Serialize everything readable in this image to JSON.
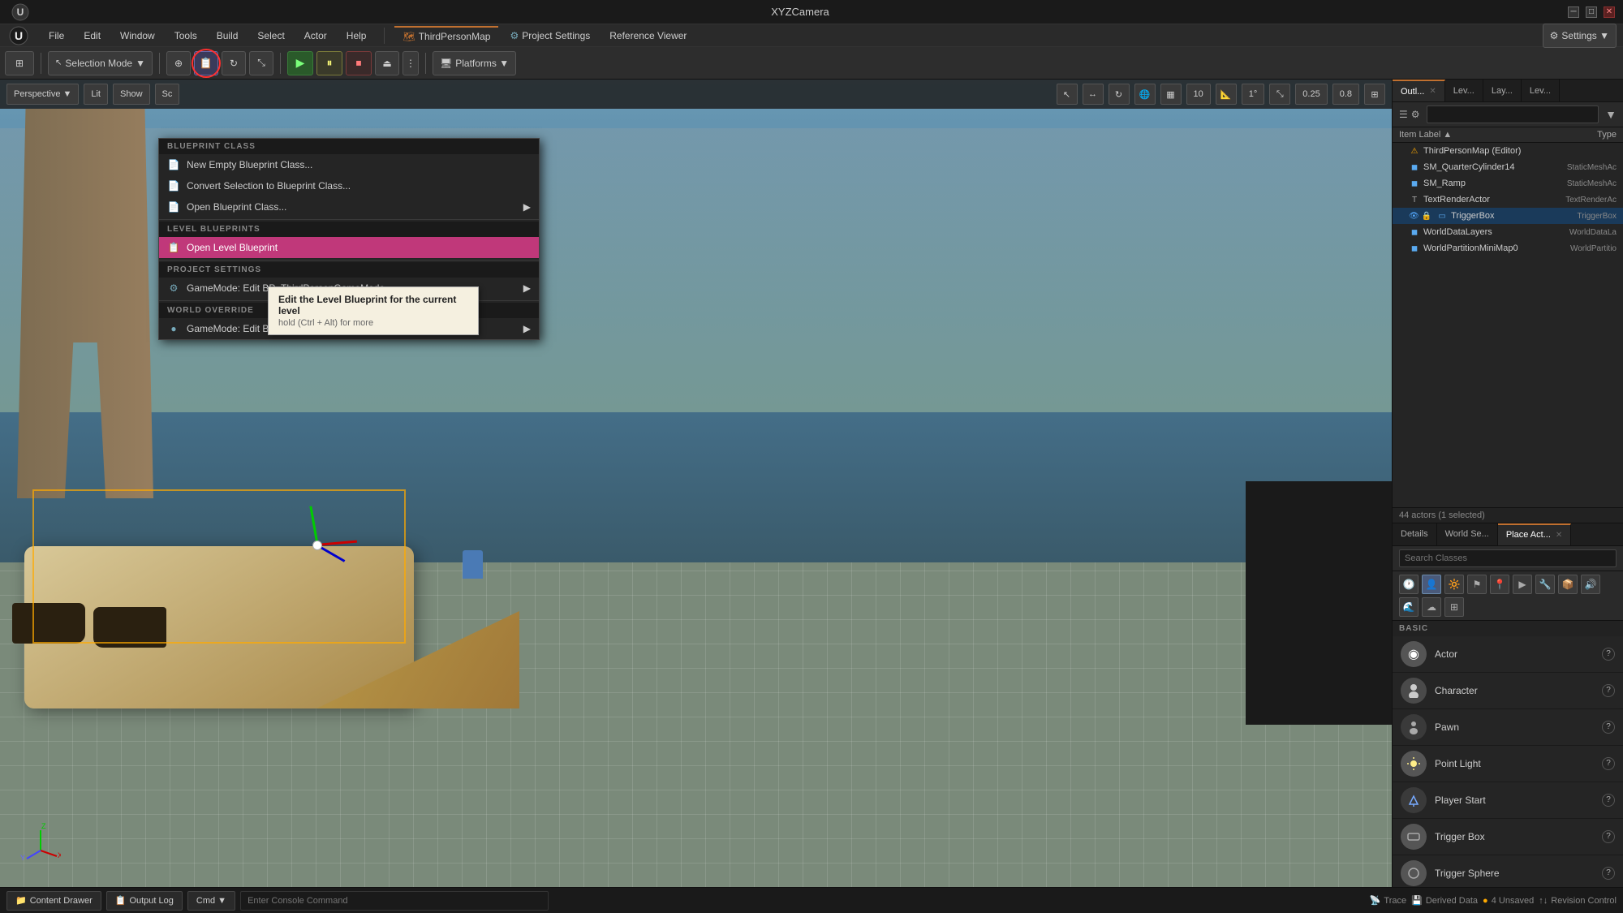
{
  "titlebar": {
    "title": "XYZCamera",
    "minimize": "─",
    "maximize": "□",
    "close": "✕"
  },
  "menubar": {
    "logo_alt": "Unreal Engine Logo",
    "tabs": [
      {
        "label": "ThirdPersonMap",
        "icon": "🗺"
      },
      {
        "label": "Project Settings"
      },
      {
        "label": "Reference Viewer"
      }
    ],
    "menus": [
      {
        "label": "File"
      },
      {
        "label": "Edit"
      },
      {
        "label": "Window"
      },
      {
        "label": "Tools"
      },
      {
        "label": "Build"
      },
      {
        "label": "Select"
      },
      {
        "label": "Actor"
      },
      {
        "label": "Help"
      }
    ]
  },
  "toolbar": {
    "selection_mode": "Selection Mode",
    "selection_mode_icon": "▼",
    "transform_icon": "⊕",
    "play_label": "▶",
    "pause_label": "⏸",
    "stop_label": "⏹",
    "eject_label": "⏏",
    "settings_label": "Settings ▼",
    "platforms_label": "Platforms ▼"
  },
  "viewport": {
    "toolbar": {
      "perspective_label": "Perspective",
      "lit_label": "Lit",
      "show_label": "Show",
      "sc_label": "Sc",
      "icons": [
        "🔍",
        "↔",
        "↻",
        "🌐",
        "▦",
        "▤",
        "10",
        "▤",
        "1°",
        "0.25",
        "0.8",
        "⊞"
      ]
    }
  },
  "blueprint_menu": {
    "sections": [
      {
        "header": "BLUEPRINT CLASS",
        "items": [
          {
            "label": "New Empty Blueprint Class...",
            "icon": "📄",
            "has_arrow": false
          },
          {
            "label": "Convert Selection to Blueprint Class...",
            "icon": "📄",
            "has_arrow": false
          },
          {
            "label": "Open Blueprint Class...",
            "icon": "📄",
            "has_arrow": true
          }
        ]
      },
      {
        "header": "LEVEL BLUEPRINTS",
        "items": [
          {
            "label": "Open Level Blueprint",
            "icon": "📋",
            "has_arrow": false,
            "active": true
          }
        ]
      },
      {
        "header": "PROJECT SETTINGS",
        "items": [
          {
            "label": "GameMode: Edit BP_ThirdPersonGameMode",
            "icon": "⚙",
            "has_arrow": true
          }
        ]
      },
      {
        "header": "WORLD OVERRIDE",
        "items": [
          {
            "label": "GameMode: Edit BP_ThirdPersonGameMode",
            "icon": "●",
            "has_arrow": true
          }
        ]
      }
    ]
  },
  "tooltip": {
    "title": "Edit the Level Blueprint for the current level",
    "sub": "hold (Ctrl + Alt) for more"
  },
  "right_panel": {
    "tabs": [
      {
        "label": "Outl...",
        "active": true,
        "closeable": true
      },
      {
        "label": "Lev...",
        "active": false,
        "closeable": false
      },
      {
        "label": "Lay...",
        "active": false,
        "closeable": false
      },
      {
        "label": "Lev...",
        "active": false,
        "closeable": false
      }
    ],
    "search_placeholder": "",
    "columns": [
      {
        "label": "Item Label ▲"
      },
      {
        "label": "Type"
      }
    ],
    "items": [
      {
        "label": "ThirdPersonMap (Editor)",
        "icon": "⚠",
        "type": "",
        "indent": 0,
        "icon_color": "#ffaa00"
      },
      {
        "label": "SM_QuarterCylinder14",
        "icon": "◼",
        "type": "StaticMeshAc",
        "indent": 1,
        "icon_color": "#5af"
      },
      {
        "label": "SM_Ramp",
        "icon": "◼",
        "type": "StaticMeshAc",
        "indent": 1,
        "icon_color": "#5af"
      },
      {
        "label": "TextRenderActor",
        "icon": "T",
        "type": "TextRenderAc",
        "indent": 1,
        "icon_color": "#aaa"
      },
      {
        "label": "TriggerBox",
        "icon": "▭",
        "type": "TriggerBox",
        "indent": 1,
        "icon_color": "#5af",
        "selected": true,
        "visible": true,
        "locked": false
      },
      {
        "label": "WorldDataLayers",
        "icon": "◼",
        "type": "WorldDataLa",
        "indent": 1,
        "icon_color": "#5af"
      },
      {
        "label": "WorldPartitionMiniMap0",
        "icon": "◼",
        "type": "WorldPartitio",
        "indent": 1,
        "icon_color": "#5af"
      }
    ],
    "actor_count": "44 actors (1 selected)"
  },
  "bottom_panel": {
    "tabs": [
      {
        "label": "Details",
        "active": false
      },
      {
        "label": "World Se...",
        "active": false
      },
      {
        "label": "Place Act...",
        "active": true,
        "closeable": true
      }
    ],
    "search_placeholder": "Search Classes",
    "filter_icons": [
      "🕐",
      "👤",
      "🔆",
      "⚑",
      "📍",
      "▶",
      "🔧",
      "📦",
      "🔊",
      "🌊",
      "☁",
      "⊞"
    ],
    "section_label": "BASIC",
    "actors": [
      {
        "label": "Actor",
        "icon": "◉",
        "icon_bg": "#555"
      },
      {
        "label": "Character",
        "icon": "👤",
        "icon_bg": "#555"
      },
      {
        "label": "Pawn",
        "icon": "👤",
        "icon_bg": "#3a3a3a"
      },
      {
        "label": "Point Light",
        "icon": "💡",
        "icon_bg": "#555"
      },
      {
        "label": "Player Start",
        "icon": "🎮",
        "icon_bg": "#3a3a3a"
      },
      {
        "label": "Trigger Box",
        "icon": "▭",
        "icon_bg": "#555"
      },
      {
        "label": "Trigger Sphere",
        "icon": "◯",
        "icon_bg": "#555"
      }
    ]
  },
  "bottombar": {
    "content_drawer_label": "Content Drawer",
    "output_log_label": "Output Log",
    "cmd_label": "Cmd ▼",
    "console_placeholder": "Enter Console Command",
    "trace_label": "Trace",
    "derived_data_label": "Derived Data",
    "unsaved_label": "4 Unsaved",
    "revision_label": "Revision Control"
  },
  "colors": {
    "accent_orange": "#c07030",
    "accent_blue": "#4a80c0",
    "active_pink": "#c0387a",
    "play_green": "#3a7a3a",
    "text_muted": "#888888"
  }
}
